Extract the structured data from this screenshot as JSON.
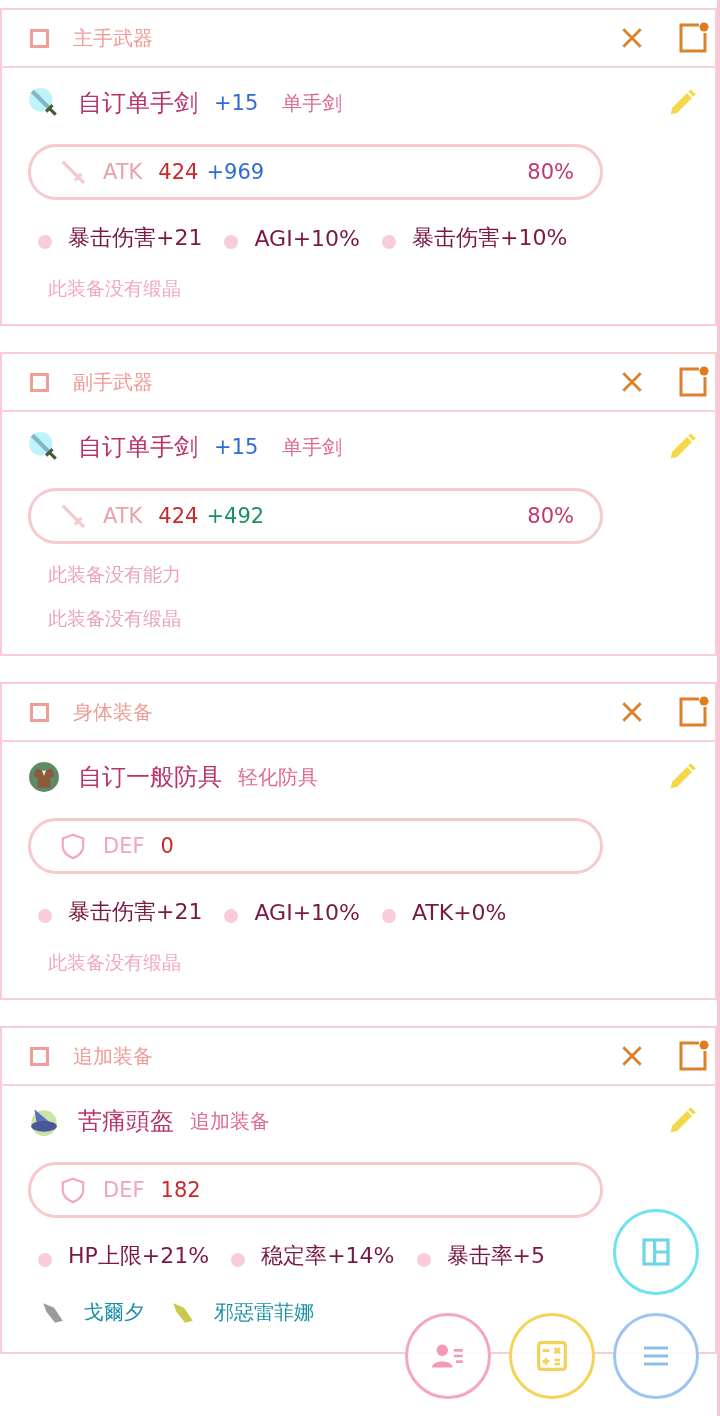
{
  "cards": [
    {
      "title": "主手武器",
      "checked": false,
      "item": {
        "kind": "sword",
        "name": "自订单手剑",
        "refine": "+15",
        "type": "单手剑"
      },
      "stat": {
        "kind": "atk",
        "label": "ATK",
        "base": "424",
        "bonus": {
          "text": "+969",
          "color": "#2f6bd8"
        },
        "percent": "80%"
      },
      "abilities": [
        "暴击伤害+21",
        "AGI+10%",
        "暴击伤害+10%"
      ],
      "no_crystals": "此装备没有缎晶"
    },
    {
      "title": "副手武器",
      "checked": false,
      "item": {
        "kind": "sword",
        "name": "自订单手剑",
        "refine": "+15",
        "type": "单手剑"
      },
      "stat": {
        "kind": "atk",
        "label": "ATK",
        "base": "424",
        "bonus": {
          "text": "+492",
          "color": "#1a9060"
        },
        "percent": "80%"
      },
      "no_abilities": "此装备没有能力",
      "no_crystals": "此装备没有缎晶"
    },
    {
      "title": "身体装备",
      "checked": false,
      "item": {
        "kind": "armor",
        "name": "自订一般防具",
        "type": "轻化防具"
      },
      "stat": {
        "kind": "def",
        "label": "DEF",
        "base": "0"
      },
      "abilities": [
        "暴击伤害+21",
        "AGI+10%",
        "ATK+0%"
      ],
      "no_crystals": "此装备没有缎晶"
    },
    {
      "title": "追加装备",
      "checked": false,
      "item": {
        "kind": "hat",
        "name": "苦痛頭盔",
        "type": "追加装备"
      },
      "stat": {
        "kind": "def",
        "label": "DEF",
        "base": "182"
      },
      "abilities": [
        "HP上限+21%",
        "稳定率+14%",
        "暴击率+5"
      ],
      "crystals": [
        {
          "name": "戈爾夕",
          "color": "#9a9a9a"
        },
        {
          "name": "邪惡雷菲娜",
          "color": "#c8c84a"
        }
      ]
    }
  ]
}
